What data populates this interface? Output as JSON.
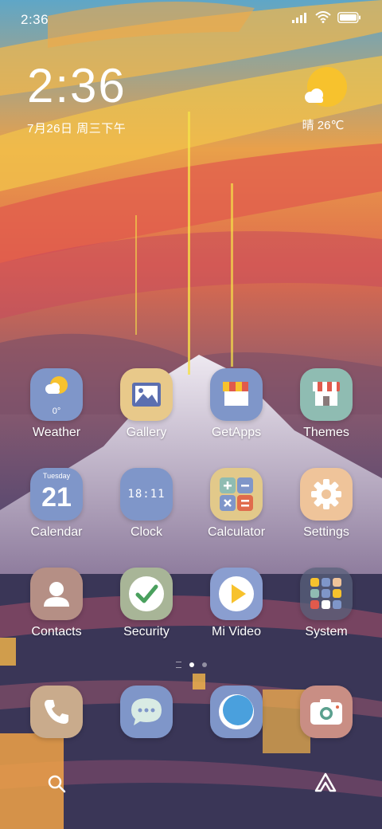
{
  "status_bar": {
    "time": "2:36",
    "icons": [
      "signal-icon",
      "wifi-icon",
      "battery-icon"
    ]
  },
  "clock_widget": {
    "time": "2:36",
    "date": "7月26日 周三下午"
  },
  "weather_widget": {
    "condition_temp": "晴 26℃",
    "icon": "sunny-cloud-icon"
  },
  "apps": [
    {
      "label": "Weather",
      "icon": "weather-icon",
      "temp": "0°",
      "color": "#7f96c9"
    },
    {
      "label": "Gallery",
      "icon": "gallery-icon",
      "color": "#e8c98a"
    },
    {
      "label": "GetApps",
      "icon": "getapps-icon",
      "color": "#7f96c9"
    },
    {
      "label": "Themes",
      "icon": "themes-icon",
      "color": "#8fbcb2"
    },
    {
      "label": "Calendar",
      "icon": "calendar-icon",
      "month": "Tuesday",
      "day": "21",
      "color": "#7f96c9"
    },
    {
      "label": "Clock",
      "icon": "clock-icon",
      "digits": "18:11",
      "color": "#7f96c9"
    },
    {
      "label": "Calculator",
      "icon": "calculator-icon",
      "color": "#e2c98a"
    },
    {
      "label": "Settings",
      "icon": "settings-icon",
      "color": "#efc49a"
    },
    {
      "label": "Contacts",
      "icon": "contacts-icon",
      "color": "#b58f85"
    },
    {
      "label": "Security",
      "icon": "security-icon",
      "color": "#a8b597"
    },
    {
      "label": "Mi Video",
      "icon": "mivideo-icon",
      "color": "#8a9ed0"
    },
    {
      "label": "System",
      "icon": "system-folder-icon",
      "color": "#58607a"
    }
  ],
  "dock": [
    {
      "icon": "phone-icon",
      "color": "#c9ab8c"
    },
    {
      "icon": "messages-icon",
      "color": "#7f96c9"
    },
    {
      "icon": "browser-icon",
      "color": "#7f96c9"
    },
    {
      "icon": "camera-icon",
      "color": "#c98e84"
    }
  ],
  "bottom_bar": {
    "left_icon": "search-icon",
    "right_icon": "assistant-icon"
  }
}
